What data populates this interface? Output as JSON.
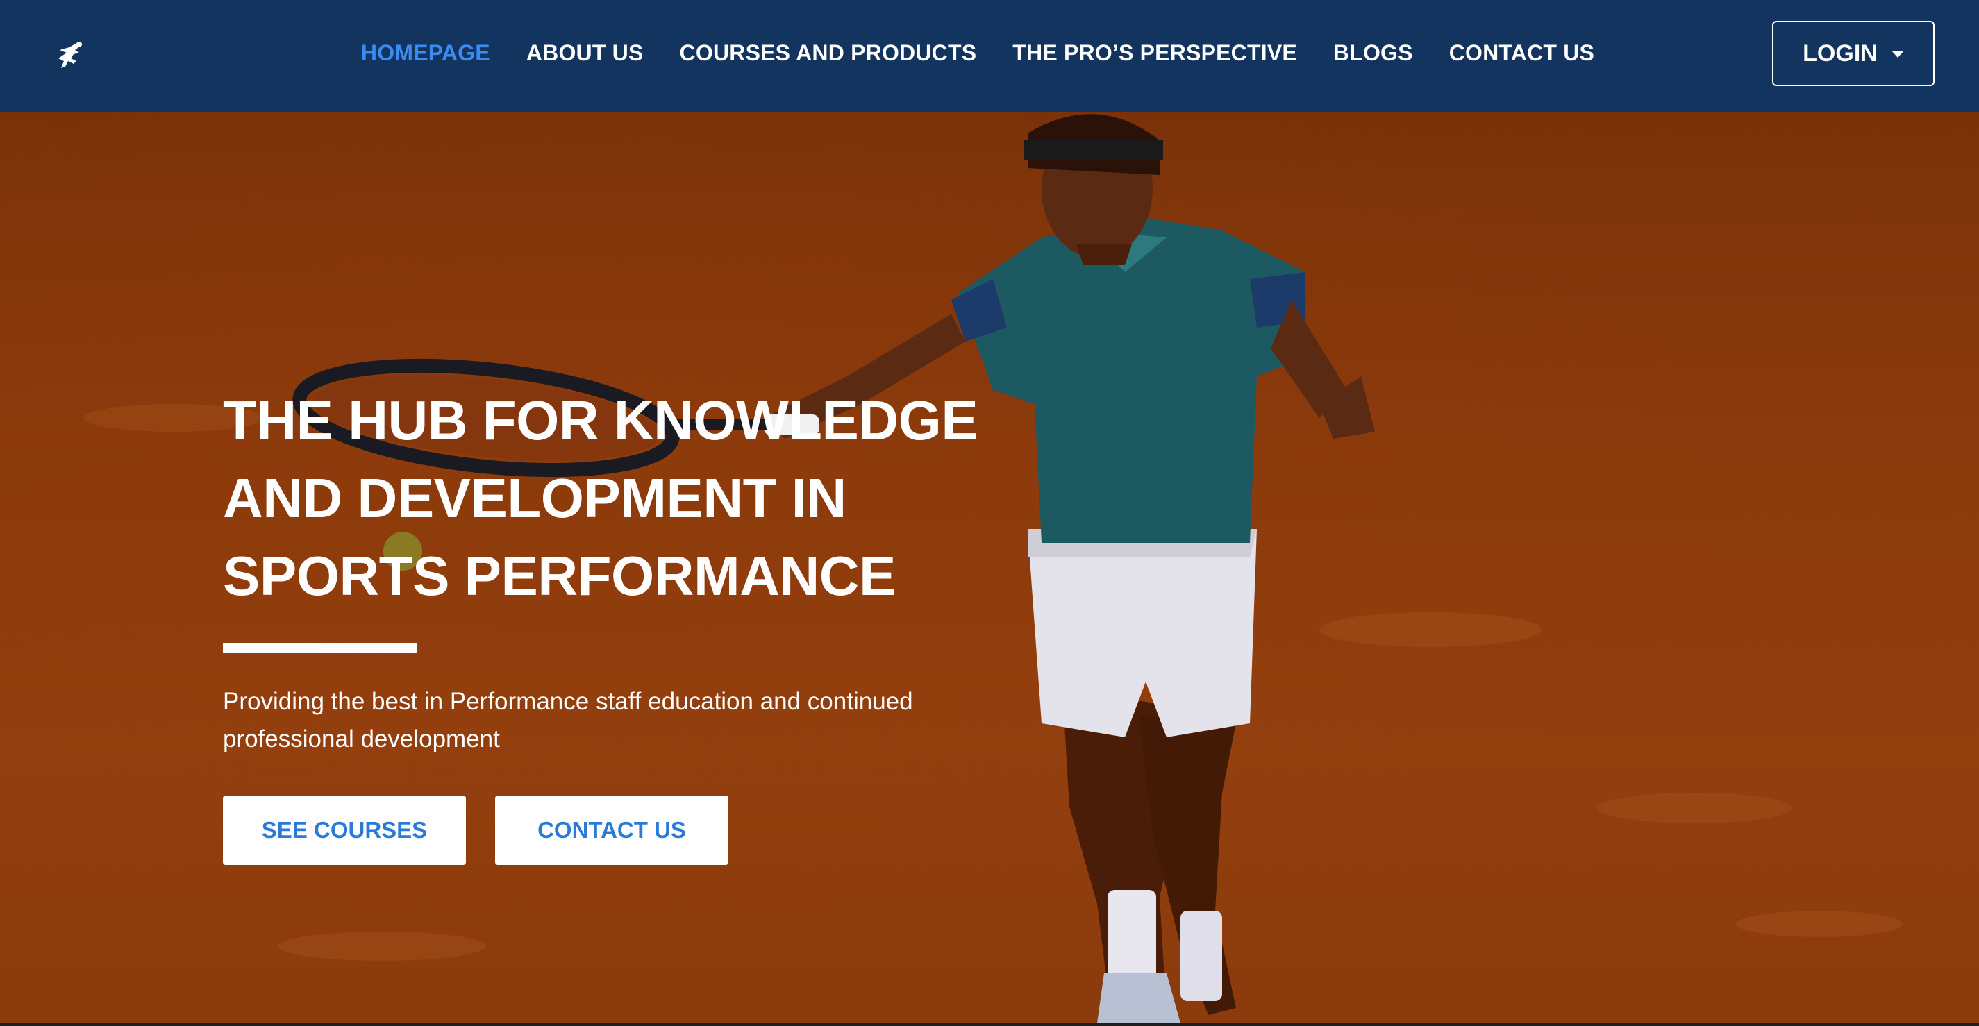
{
  "nav": {
    "logo_icon": "runner-logo-icon",
    "links": [
      {
        "label": "HOMEPAGE",
        "active": true
      },
      {
        "label": "ABOUT US",
        "active": false
      },
      {
        "label": "COURSES AND PRODUCTS",
        "active": false
      },
      {
        "label": "THE PRO’S PERSPECTIVE",
        "active": false
      },
      {
        "label": "BLOGS",
        "active": false
      },
      {
        "label": "CONTACT US",
        "active": false
      }
    ],
    "login_label": "LOGIN"
  },
  "hero": {
    "title": "THE HUB FOR KNOWLEDGE AND DEVELOPMENT IN SPORTS PERFORMANCE",
    "subtitle": "Providing the best in Performance staff education and continued professional development",
    "buttons": {
      "see_courses": "SEE COURSES",
      "contact_us": "CONTACT US"
    },
    "background_image": "tennis-player-forehand-on-clay-court"
  },
  "colors": {
    "navbar_bg": "#12345e",
    "active_link": "#3b8cf0",
    "button_text": "#2a7ad8",
    "hero_tint": "#8a3a0c"
  }
}
